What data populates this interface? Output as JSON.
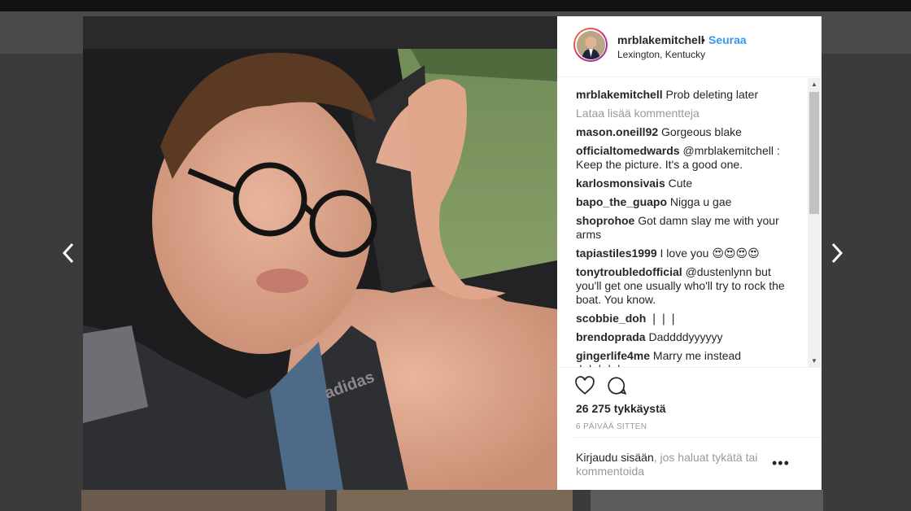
{
  "post": {
    "username": "mrblakemitchell",
    "dot": "•",
    "follow_label": "Seuraa",
    "location": "Lexington, Kentucky",
    "caption_user": "mrblakemitchell",
    "caption_text": "Prob deleting later",
    "load_more": "Lataa lisää kommentteja",
    "comments": [
      {
        "user": "mason.oneill92",
        "text": "Gorgeous blake"
      },
      {
        "user": "officialtomedwards",
        "text": "@mrblakemitchell : Keep the picture. It's a good one."
      },
      {
        "user": "karlosmonsivais",
        "text": "Cute"
      },
      {
        "user": "bapo_the_guapo",
        "text": "Nigga u gae"
      },
      {
        "user": "shoprohoe",
        "text": "Got damn slay me with your arms"
      },
      {
        "user": "tapiastiles1999",
        "text": "I love you 😍😍😍😍"
      },
      {
        "user": "tonytroubledofficial",
        "text": "@dustenlynn but you'll get one usually who'll try to rock the boat. You know."
      },
      {
        "user": "scobbie_doh",
        "text": "❘❘❘"
      },
      {
        "user": "brendoprada",
        "text": "Daddddyyyyyy"
      },
      {
        "user": "gingerlife4me",
        "text": "Marry me instead ❘❘❘❘❘"
      }
    ],
    "likes": "26 275 tykkäystä",
    "time": "6 PÄIVÄÄ SITTEN",
    "login_link": "Kirjaudu sisään",
    "login_rest": ", jos haluat tykätä tai kommentoida",
    "more_label": "•••"
  },
  "icons": {
    "heart": "heart-icon",
    "comment": "comment-icon",
    "prev": "chevron-left-icon",
    "next": "chevron-right-icon"
  }
}
